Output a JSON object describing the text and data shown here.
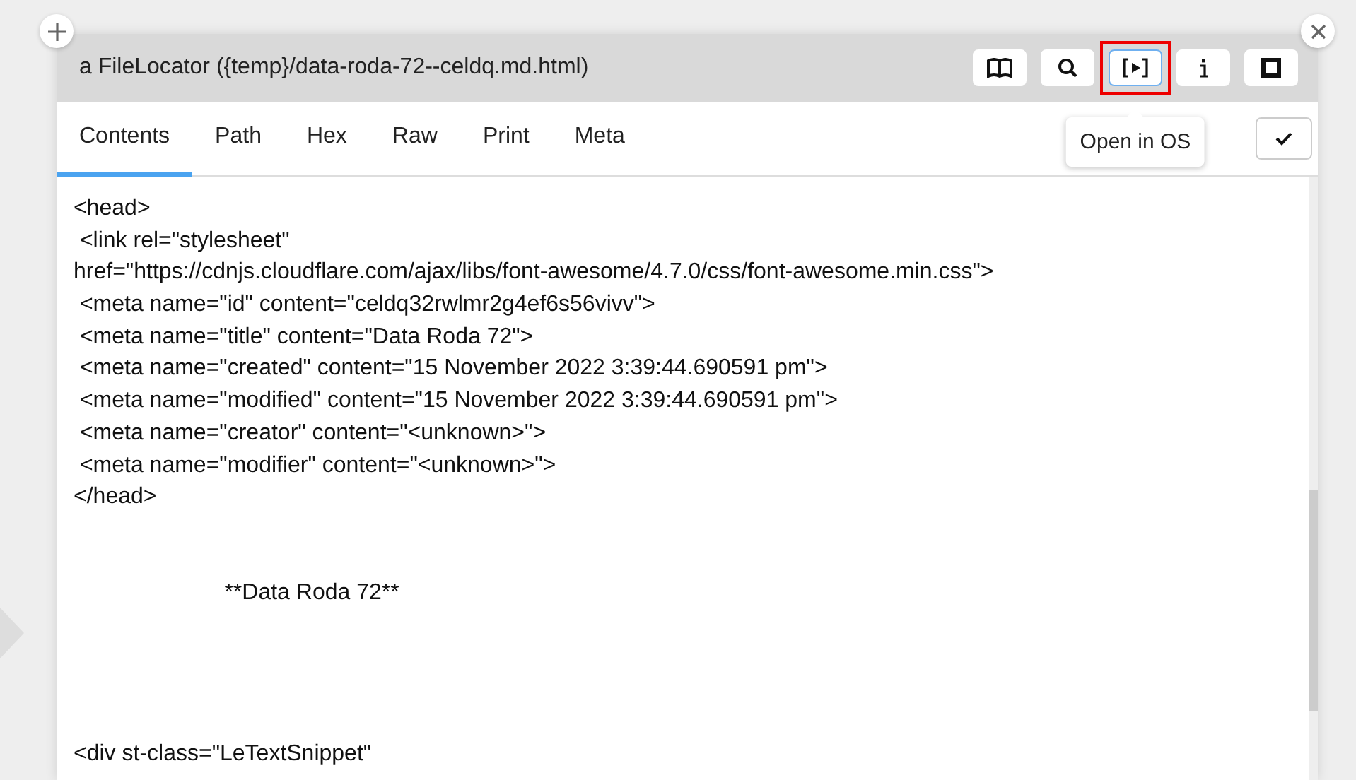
{
  "window": {
    "title": "a FileLocator ({temp}/data-roda-72--celdq.md.html)"
  },
  "toolbar": [
    {
      "kind": "book",
      "selected": false,
      "highlighted": false
    },
    {
      "kind": "search",
      "selected": false,
      "highlighted": false
    },
    {
      "kind": "open",
      "selected": true,
      "highlighted": true,
      "tooltip": "Open in OS"
    },
    {
      "kind": "info",
      "selected": false,
      "highlighted": false
    },
    {
      "kind": "stop",
      "selected": false,
      "highlighted": false
    }
  ],
  "tabs": [
    {
      "label": "Contents",
      "selected": true
    },
    {
      "label": "Path",
      "selected": false
    },
    {
      "label": "Hex",
      "selected": false
    },
    {
      "label": "Raw",
      "selected": false
    },
    {
      "label": "Print",
      "selected": false
    },
    {
      "label": "Meta",
      "selected": false
    }
  ],
  "contents": {
    "blocks": [
      [
        "<head>",
        " <link rel=\"stylesheet\"",
        "href=\"https://cdnjs.cloudflare.com/ajax/libs/font-awesome/4.7.0/css/font-awesome.min.css\">",
        " <meta name=\"id\" content=\"celdq32rwlmr2g4ef6s56vivv\">",
        " <meta name=\"title\" content=\"Data Roda 72\">",
        " <meta name=\"created\" content=\"15 November 2022 3:39:44.690591 pm\">",
        " <meta name=\"modified\" content=\"15 November 2022 3:39:44.690591 pm\">",
        " <meta name=\"creator\" content=\"<unknown>\">",
        " <meta name=\"modifier\" content=\"<unknown>\">",
        "</head>"
      ],
      [
        "                        **Data Roda 72**"
      ],
      [
        "<div st-class=\"LeTextSnippet\""
      ]
    ]
  }
}
